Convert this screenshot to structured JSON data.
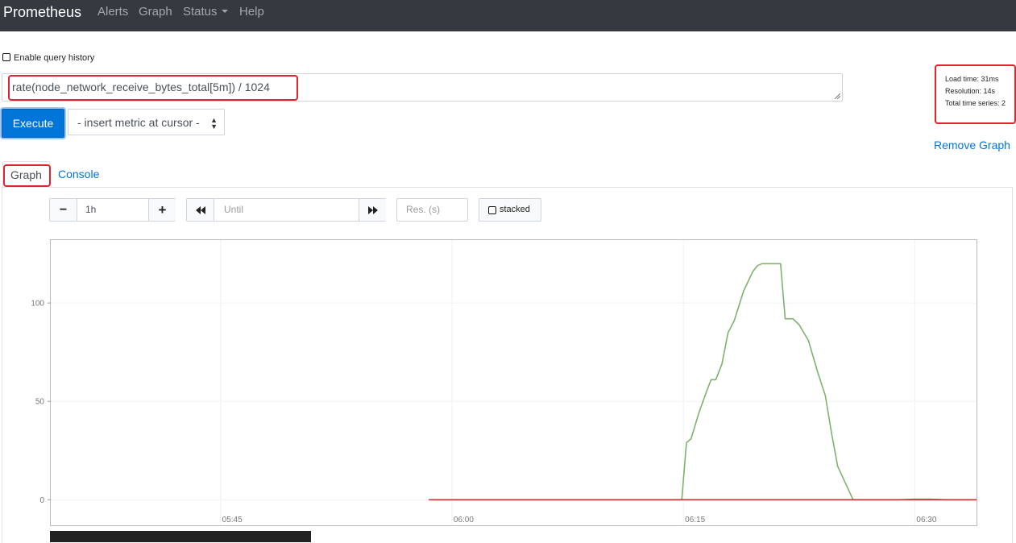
{
  "navbar": {
    "brand": "Prometheus",
    "items": [
      {
        "label": "Alerts"
      },
      {
        "label": "Graph"
      },
      {
        "label": "Status"
      },
      {
        "label": "Help"
      }
    ]
  },
  "query_history": {
    "label": "Enable query history",
    "checked": false
  },
  "expression": {
    "value": "rate(node_network_receive_bytes_total[5m]) / 1024"
  },
  "execute": {
    "label": "Execute"
  },
  "metric_select": {
    "value": "- insert metric at cursor -"
  },
  "stats": {
    "load_time": "Load time: 31ms",
    "resolution": "Resolution: 14s",
    "total_series": "Total time series: 2"
  },
  "remove_graph": {
    "label": "Remove Graph"
  },
  "tabs": [
    {
      "label": "Graph",
      "active": true
    },
    {
      "label": "Console",
      "active": false
    }
  ],
  "controls": {
    "minus": "−",
    "range": "1h",
    "plus": "+",
    "back_icon": "backward-icon",
    "until_placeholder": "Until",
    "forward_icon": "forward-icon",
    "res_placeholder": "Res. (s)",
    "stacked_label": "stacked",
    "stacked_checked": false
  },
  "chart_data": {
    "type": "line",
    "y_ticks": [
      "0",
      "50",
      "100"
    ],
    "x_ticks": [
      "05:45",
      "06:00",
      "06:15",
      "06:30"
    ],
    "ylim": [
      -13,
      132
    ],
    "x_range_minutes": [
      0,
      60
    ],
    "x_tick_minutes": [
      11,
      26,
      41,
      56
    ],
    "grid": true,
    "series": [
      {
        "color": "#7eb26d",
        "x_minutes": [
          24.5,
          40.9,
          41.2,
          41.5,
          42.0,
          42.5,
          42.8,
          43.1,
          43.5,
          43.9,
          44.3,
          44.9,
          45.5,
          45.8,
          46.1,
          47.3,
          47.6,
          48.1,
          48.5,
          49.1,
          49.7,
          50.2,
          50.6,
          51.0,
          52.0,
          55.0,
          56.0,
          57.0,
          58.0,
          60.0
        ],
        "y": [
          0,
          0,
          29,
          31,
          44,
          55,
          61,
          61,
          69,
          85,
          91,
          106,
          116,
          119,
          120,
          120,
          92,
          92,
          89,
          81,
          65,
          53,
          34,
          17,
          0,
          0,
          0.3,
          0.3,
          0,
          0
        ]
      },
      {
        "color": "#c4362f",
        "x_minutes": [
          24.5,
          60.0
        ],
        "y": [
          0,
          0
        ]
      }
    ]
  }
}
